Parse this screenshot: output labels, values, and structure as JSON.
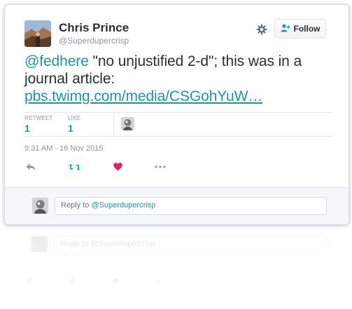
{
  "user": {
    "name": "Chris Prince",
    "handle": "@Superdupercrisp",
    "follow_label": "Follow"
  },
  "tweet": {
    "mention": "@fedhere",
    "text_part1": " \"no unjustified 2-d\"; this was in a journal article: ",
    "link": "pbs.twimg.com/media/CSGohYuW…"
  },
  "stats": {
    "retweet_label": "RETWEET",
    "retweet_count": "1",
    "like_label": "LIKE",
    "like_count": "1"
  },
  "timestamp": "9:31 AM - 16 Nov 2015",
  "reply": {
    "prefix": "Reply to ",
    "mention": "@Superdupercrisp"
  },
  "icons": {
    "settings": "gear-icon",
    "follow": "add-person-icon",
    "reply": "reply-arrow-icon",
    "retweet": "retweet-icon",
    "like": "heart-icon",
    "more": "more-dots-icon"
  },
  "colors": {
    "accent": "#1b95a4",
    "like": "#e0245e",
    "retweet": "#19cf86",
    "muted": "#8899a6"
  }
}
